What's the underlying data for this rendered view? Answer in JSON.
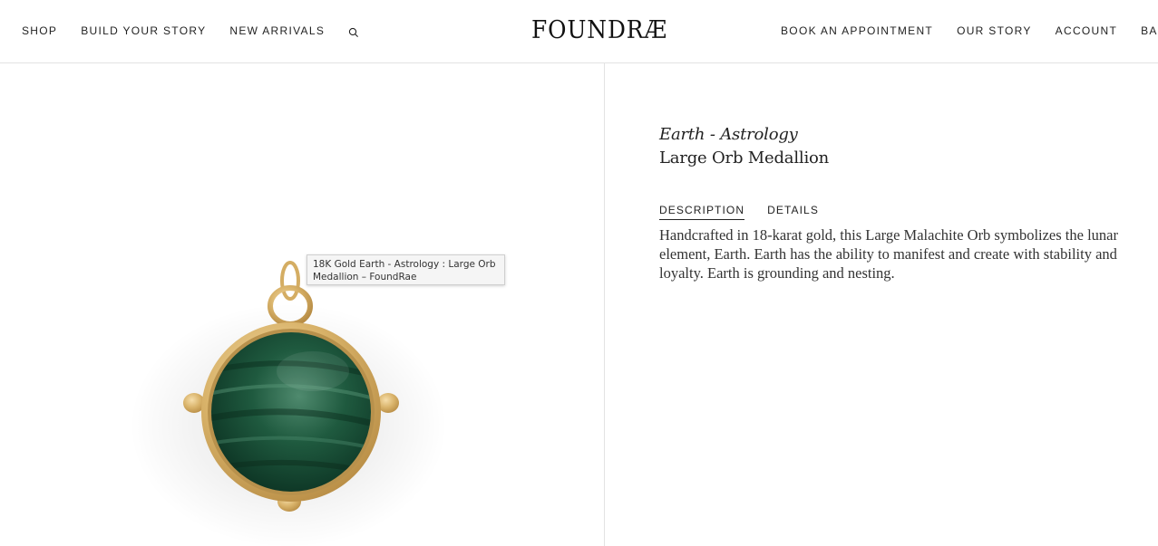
{
  "header": {
    "logo": "FOUNDRÆ",
    "nav_left": [
      {
        "label": "SHOP"
      },
      {
        "label": "BUILD YOUR STORY"
      },
      {
        "label": "NEW ARRIVALS"
      }
    ],
    "nav_right": [
      {
        "label": "BOOK AN APPOINTMENT"
      },
      {
        "label": "OUR STORY"
      },
      {
        "label": "ACCOUNT"
      },
      {
        "label": "BAG"
      }
    ],
    "search_icon": "search-icon"
  },
  "product": {
    "collection": "Earth - Astrology",
    "name": "Large Orb Medallion",
    "image_tooltip": "18K Gold Earth - Astrology : Large Orb Medallion – FoundRae",
    "tabs": [
      {
        "label": "DESCRIPTION",
        "active": true
      },
      {
        "label": "DETAILS",
        "active": false
      }
    ],
    "description": "Handcrafted in 18-karat gold, this Large Malachite Orb symbolizes the lunar element, Earth. Earth has the ability to manifest and create with stability and loyalty. Earth is grounding and nesting."
  },
  "colors": {
    "gold": "#d9b36a",
    "malachite": "#1f5a3f",
    "border": "#e3e3e3"
  }
}
